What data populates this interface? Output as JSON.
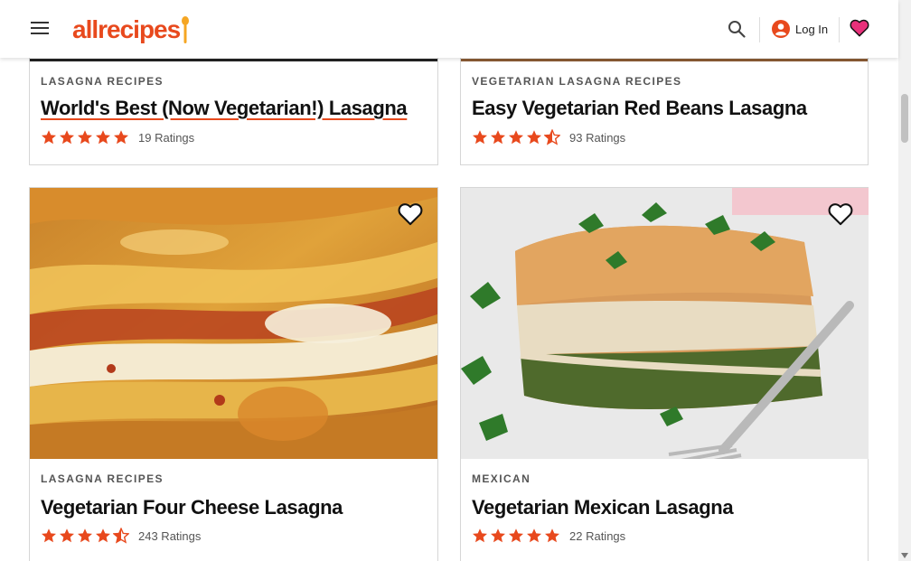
{
  "header": {
    "logo_text": "allrecipes",
    "login_label": "Log In"
  },
  "icons": {
    "menu": "hamburger-menu-icon",
    "search": "search-icon",
    "account": "account-icon",
    "favorites": "heart-icon",
    "star": "star-icon",
    "star_half": "star-half-icon"
  },
  "colors": {
    "brand": "#e8491d",
    "favorites_heart": "#e8317a"
  },
  "cards": [
    {
      "category": "LASAGNA RECIPES",
      "title": "World's Best (Now Vegetarian!) Lasagna",
      "stars": 5,
      "ratings": "19 Ratings"
    },
    {
      "category": "VEGETARIAN LASAGNA RECIPES",
      "title": "Easy Vegetarian Red Beans Lasagna",
      "stars": 4.5,
      "ratings": "93 Ratings"
    },
    {
      "category": "LASAGNA RECIPES",
      "title": "Vegetarian Four Cheese Lasagna",
      "stars": 4.5,
      "ratings": "243 Ratings"
    },
    {
      "category": "MEXICAN",
      "title": "Vegetarian Mexican Lasagna",
      "stars": 5,
      "ratings": "22 Ratings"
    }
  ]
}
